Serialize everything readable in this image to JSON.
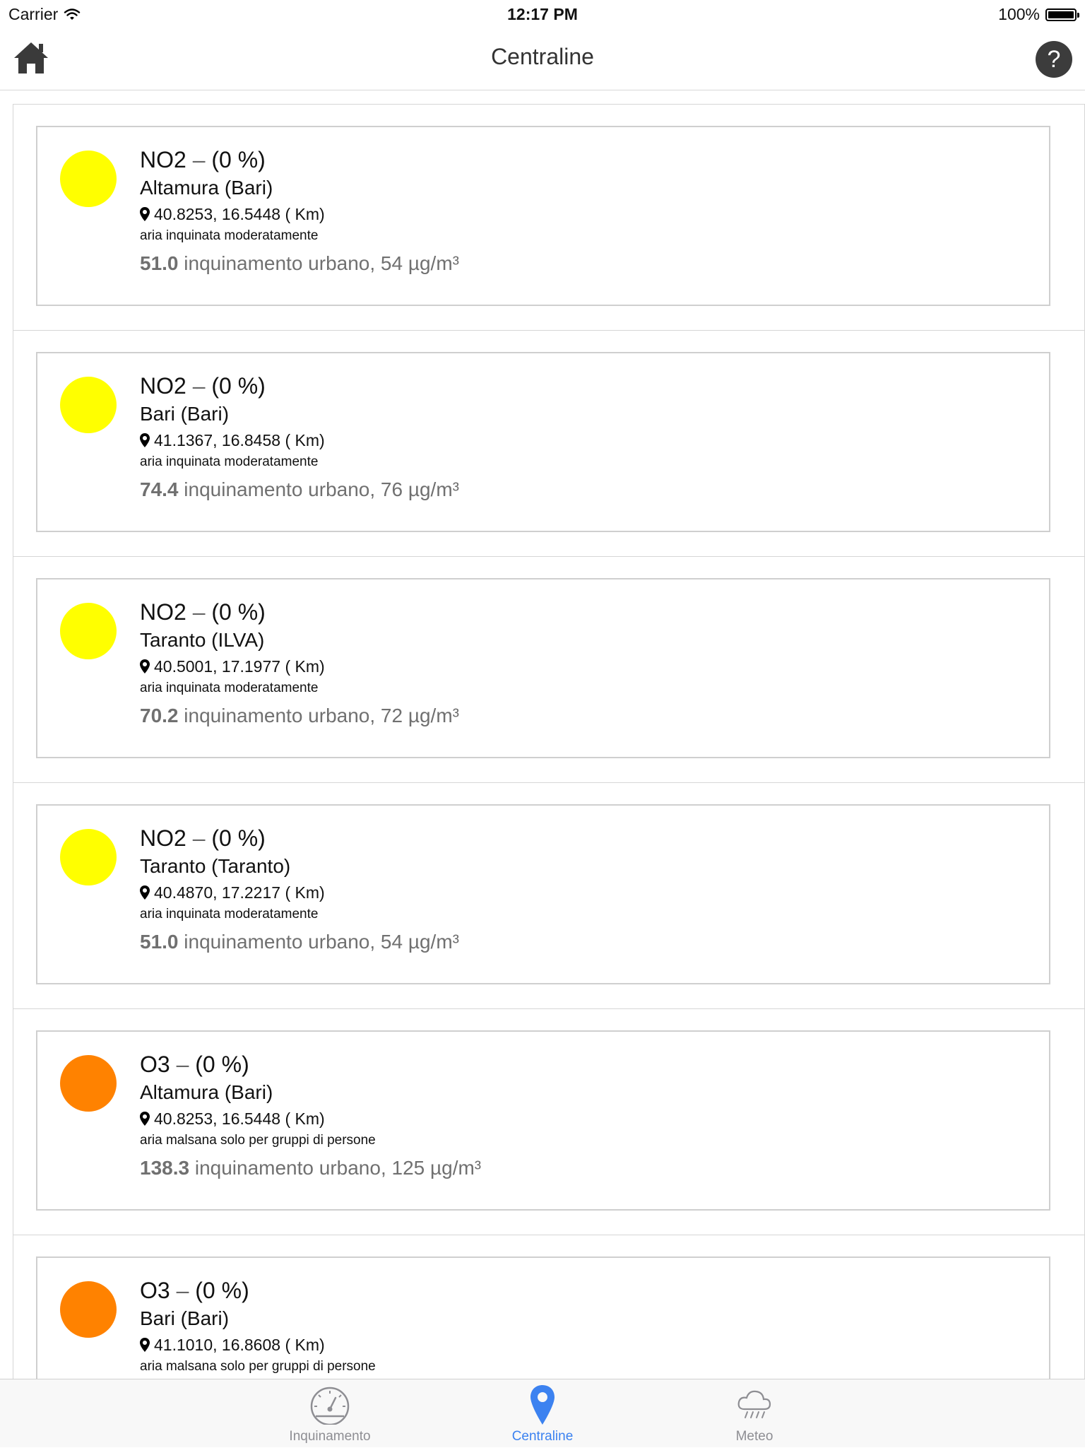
{
  "status_bar": {
    "carrier": "Carrier",
    "time": "12:17 PM",
    "battery": "100%"
  },
  "nav": {
    "title": "Centraline",
    "help_label": "?"
  },
  "colors": {
    "yellow": "#ffff00",
    "orange": "#ff8200",
    "accent": "#3c82f0"
  },
  "stations": [
    {
      "pollutant": "NO2",
      "dash": "–",
      "percent": "(0 %)",
      "station": "Altamura (Bari)",
      "coords": "40.8253, 16.5448 ( Km)",
      "description": "aria inquinata moderatamente",
      "value": "51.0",
      "detail": "inquinamento urbano, 54 µg/m³",
      "color": "#ffff00"
    },
    {
      "pollutant": "NO2",
      "dash": "–",
      "percent": "(0 %)",
      "station": "Bari (Bari)",
      "coords": "41.1367, 16.8458 ( Km)",
      "description": "aria inquinata moderatamente",
      "value": "74.4",
      "detail": "inquinamento urbano, 76 µg/m³",
      "color": "#ffff00"
    },
    {
      "pollutant": "NO2",
      "dash": "–",
      "percent": "(0 %)",
      "station": "Taranto (ILVA)",
      "coords": "40.5001, 17.1977 ( Km)",
      "description": "aria inquinata moderatamente",
      "value": "70.2",
      "detail": "inquinamento urbano, 72 µg/m³",
      "color": "#ffff00"
    },
    {
      "pollutant": "NO2",
      "dash": "–",
      "percent": "(0 %)",
      "station": "Taranto (Taranto)",
      "coords": "40.4870, 17.2217 ( Km)",
      "description": "aria inquinata moderatamente",
      "value": "51.0",
      "detail": "inquinamento urbano, 54 µg/m³",
      "color": "#ffff00"
    },
    {
      "pollutant": "O3",
      "dash": "–",
      "percent": "(0 %)",
      "station": "Altamura (Bari)",
      "coords": "40.8253, 16.5448 ( Km)",
      "description": "aria malsana solo per gruppi di persone",
      "value": "138.3",
      "detail": "inquinamento urbano, 125 µg/m³",
      "color": "#ff8200"
    },
    {
      "pollutant": "O3",
      "dash": "–",
      "percent": "(0 %)",
      "station": "Bari (Bari)",
      "coords": "41.1010, 16.8608 ( Km)",
      "description": "aria malsana solo per gruppi di persone",
      "value": "",
      "detail": "",
      "color": "#ff8200"
    }
  ],
  "tabs": [
    {
      "label": "Inquinamento",
      "icon": "speedometer-icon",
      "active": false
    },
    {
      "label": "Centraline",
      "icon": "map-pin-icon",
      "active": true
    },
    {
      "label": "Meteo",
      "icon": "rain-cloud-icon",
      "active": false
    }
  ]
}
